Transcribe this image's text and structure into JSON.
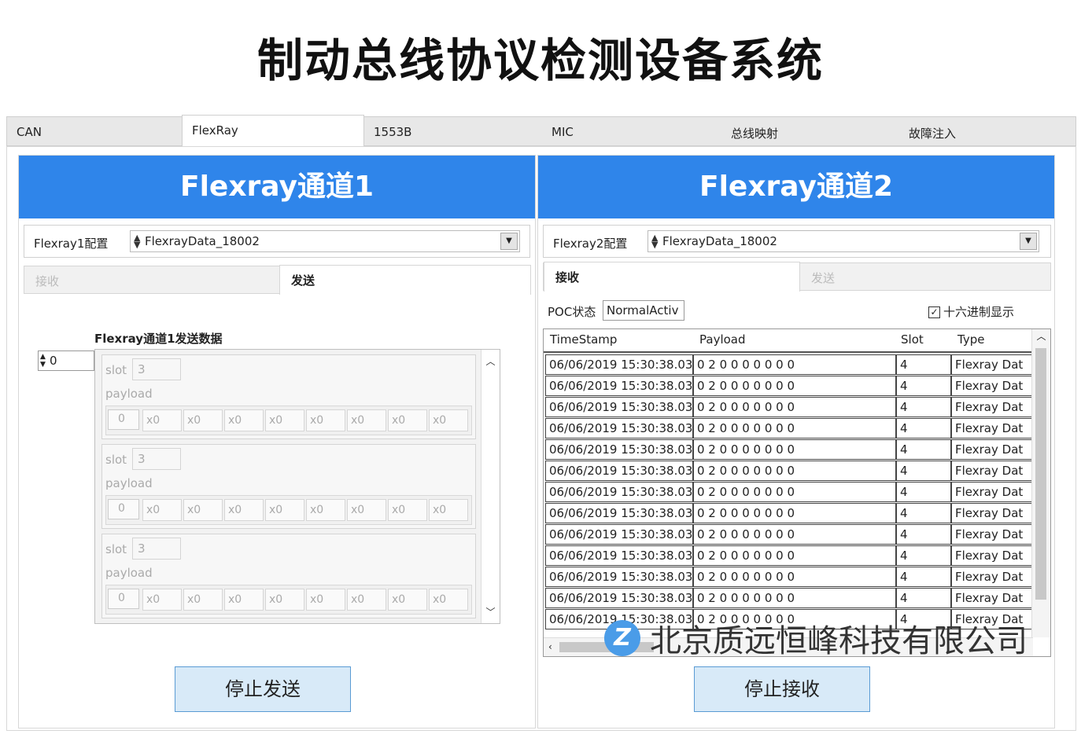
{
  "app_title": "制动总线协议检测设备系统",
  "tabs": [
    "CAN",
    "FlexRay",
    "1553B",
    "MIC",
    "总线映射",
    "故障注入"
  ],
  "channel1": {
    "title": "Flexray通道1",
    "config_label": "Flexray1配置",
    "config_value": "FlexrayData_18002",
    "subtabs": [
      "接收",
      "发送"
    ],
    "send_title": "Flexray通道1发送数据",
    "index_value": "0",
    "clusters": [
      {
        "slot_label": "slot",
        "slot_value": "3",
        "payload_label": "payload",
        "index": "0",
        "bytes": [
          "x0",
          "x0",
          "x0",
          "x0",
          "x0",
          "x0",
          "x0",
          "x0"
        ]
      },
      {
        "slot_label": "slot",
        "slot_value": "3",
        "payload_label": "payload",
        "index": "0",
        "bytes": [
          "x0",
          "x0",
          "x0",
          "x0",
          "x0",
          "x0",
          "x0",
          "x0"
        ]
      },
      {
        "slot_label": "slot",
        "slot_value": "3",
        "payload_label": "payload",
        "index": "0",
        "bytes": [
          "x0",
          "x0",
          "x0",
          "x0",
          "x0",
          "x0",
          "x0",
          "x0"
        ]
      }
    ],
    "button_label": "停止发送"
  },
  "channel2": {
    "title": "Flexray通道2",
    "config_label": "Flexray2配置",
    "config_value": "FlexrayData_18002",
    "subtabs": [
      "接收",
      "发送"
    ],
    "poc_label": "POC状态",
    "poc_value": "NormalActiv",
    "hex_display_label": "十六进制显示",
    "hex_checked": true,
    "table": {
      "columns": [
        "TimeStamp",
        "Payload",
        "Slot",
        "Type"
      ],
      "rows": [
        [
          "06/06/2019 15:30:38.03",
          "0  2  0  0  0  0  0  0  0",
          "4",
          "Flexray Dat"
        ],
        [
          "06/06/2019 15:30:38.03",
          "0  2  0  0  0  0  0  0  0",
          "4",
          "Flexray Dat"
        ],
        [
          "06/06/2019 15:30:38.03",
          "0  2  0  0  0  0  0  0  0",
          "4",
          "Flexray Dat"
        ],
        [
          "06/06/2019 15:30:38.03",
          "0  2  0  0  0  0  0  0  0",
          "4",
          "Flexray Dat"
        ],
        [
          "06/06/2019 15:30:38.03",
          "0  2  0  0  0  0  0  0  0",
          "4",
          "Flexray Dat"
        ],
        [
          "06/06/2019 15:30:38.03",
          "0  2  0  0  0  0  0  0  0",
          "4",
          "Flexray Dat"
        ],
        [
          "06/06/2019 15:30:38.03",
          "0  2  0  0  0  0  0  0  0",
          "4",
          "Flexray Dat"
        ],
        [
          "06/06/2019 15:30:38.03",
          "0  2  0  0  0  0  0  0  0",
          "4",
          "Flexray Dat"
        ],
        [
          "06/06/2019 15:30:38.03",
          "0  2  0  0  0  0  0  0  0",
          "4",
          "Flexray Dat"
        ],
        [
          "06/06/2019 15:30:38.03",
          "0  2  0  0  0  0  0  0  0",
          "4",
          "Flexray Dat"
        ],
        [
          "06/06/2019 15:30:38.03",
          "0  2  0  0  0  0  0  0  0",
          "4",
          "Flexray Dat"
        ],
        [
          "06/06/2019 15:30:38.03",
          "0  2  0  0  0  0  0  0  0",
          "4",
          "Flexray Dat"
        ],
        [
          "06/06/2019 15:30:38.03",
          "0  2  0  0  0  0  0  0  0",
          "4",
          "Flexray Dat"
        ]
      ]
    },
    "button_label": "停止接收"
  },
  "watermark": "北京质远恒峰科技有限公司",
  "colors": {
    "header_blue": "#2f85ea",
    "button_bg": "#d8eaf8",
    "button_border": "#5a9bd4"
  }
}
